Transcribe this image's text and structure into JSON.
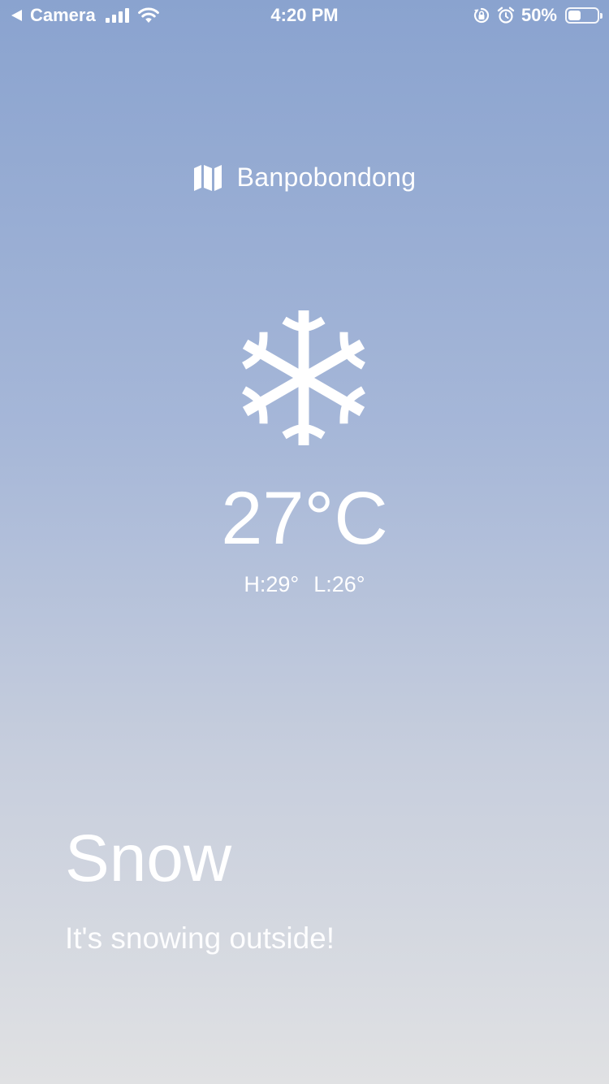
{
  "status_bar": {
    "back_app": "Camera",
    "time": "4:20 PM",
    "battery_percent": "50%",
    "battery_level": 0.5,
    "icons": [
      "back-arrow-icon",
      "signal-icon",
      "wifi-icon",
      "orientation-lock-icon",
      "alarm-icon",
      "battery-icon"
    ]
  },
  "location": {
    "icon": "map-icon",
    "name": "Banpobondong"
  },
  "weather": {
    "icon": "snowflake-icon",
    "temperature": "27°C",
    "high": "H:29°",
    "low": "L:26°",
    "condition": "Snow",
    "description": "It's snowing outside!"
  },
  "colors": {
    "gradient_top": "#8aa3cf",
    "gradient_bottom": "#e0e1e3",
    "text": "#ffffff"
  }
}
